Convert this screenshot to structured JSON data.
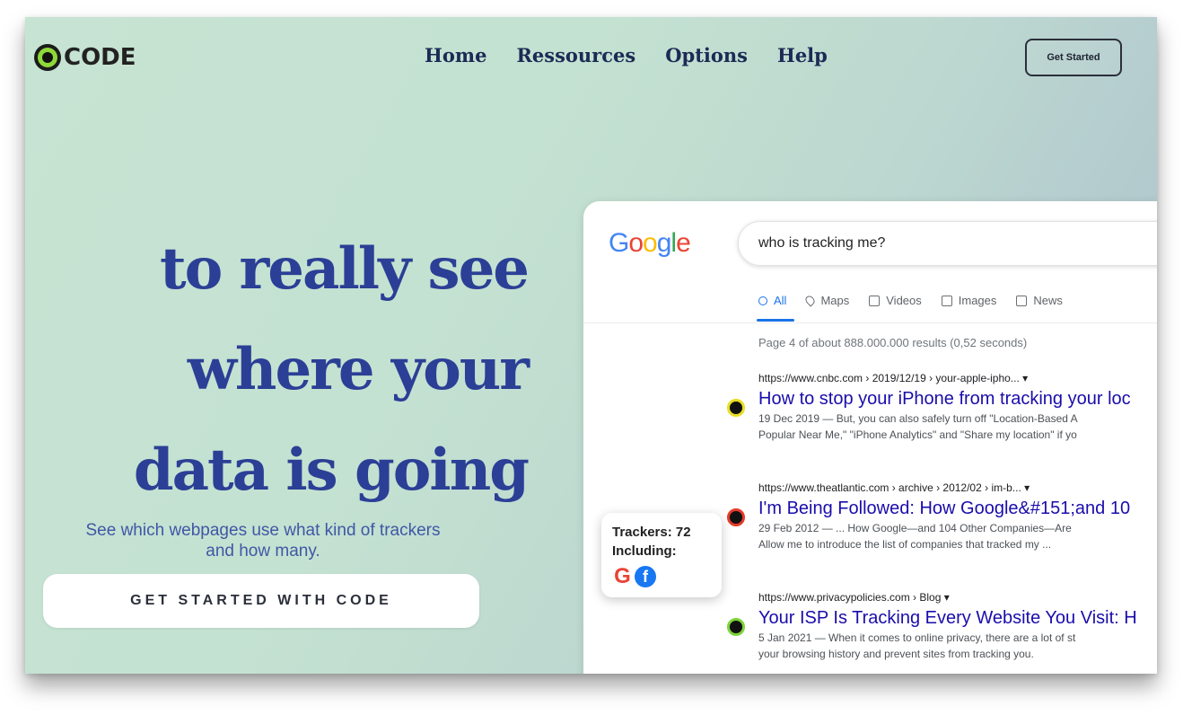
{
  "header": {
    "logo_text": "CODE",
    "nav": [
      "Home",
      "Ressources",
      "Options",
      "Help"
    ],
    "cta_label": "Get Started"
  },
  "hero": {
    "lines": [
      "to really see",
      "where your",
      "data is going"
    ],
    "subtitle_line1": "See which webpages use what kind of trackers",
    "subtitle_line2": "and how many.",
    "cta_label": "GET STARTED WITH CODE"
  },
  "search": {
    "logo": "Google",
    "query": "who is tracking me?",
    "tabs": [
      {
        "label": "All",
        "icon": "search-icon"
      },
      {
        "label": "Maps",
        "icon": "map-pin-icon"
      },
      {
        "label": "Videos",
        "icon": "video-icon"
      },
      {
        "label": "Images",
        "icon": "image-icon"
      },
      {
        "label": "News",
        "icon": "news-icon"
      }
    ],
    "stats": "Page 4 of about 888.000.000 results (0,52 seconds)",
    "results": [
      {
        "url": "https://www.cnbc.com › 2019/12/19 › your-apple-ipho... ▾",
        "title": "How to stop your iPhone from tracking your loc",
        "snippet1": "19 Dec 2019 — But, you can also safely turn off \"Location-Based A",
        "snippet2": "Popular Near Me,\" \"iPhone Analytics\" and \"Share my location\" if yo",
        "indicator": "yellow"
      },
      {
        "url": "https://www.theatlantic.com › archive › 2012/02 › im-b... ▾",
        "title": "I'm Being Followed: How Google&#151;and 10",
        "snippet1": "29 Feb 2012 — ... How Google—and 104 Other Companies—Are",
        "snippet2": "Allow me to introduce the list of companies that tracked my ...",
        "indicator": "red"
      },
      {
        "url": "https://www.privacypolicies.com › Blog ▾",
        "title": "Your ISP Is Tracking Every Website You Visit: H",
        "snippet1": "5 Jan 2021 — When it comes to online privacy, there are a lot of st",
        "snippet2": "your browsing history and prevent sites from tracking you.",
        "indicator": "green"
      }
    ]
  },
  "tracker_popup": {
    "count_label": "Trackers: 72",
    "including_label": "Including:",
    "icons": [
      "google-icon",
      "facebook-icon"
    ]
  },
  "colors": {
    "hero_text": "#2b3f96",
    "nav_text": "#1c2a55",
    "link_blue": "#1a0dab",
    "accent_green": "#8fd83a"
  }
}
